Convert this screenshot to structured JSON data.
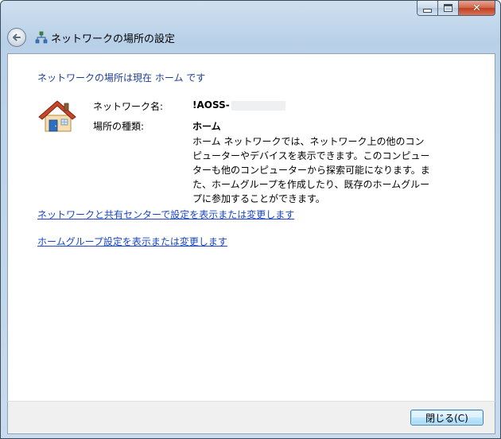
{
  "window": {
    "title": "ネットワークの場所の設定"
  },
  "caption": {
    "close_glyph": "✕"
  },
  "content": {
    "status_line": "ネットワークの場所は現在 ホーム です",
    "network_name_label": "ネットワーク名:",
    "network_name_value": "!AOSS-",
    "location_type_label": "場所の種類:",
    "location_type_value": "ホーム",
    "description": "ホーム ネットワークでは、ネットワーク上の他のコンピューターやデバイスを表示できます。このコンピューターも他のコンピューターから探索可能になります。また、ホームグループを作成したり、既存のホームグループに参加することができます。",
    "link_network_center": "ネットワークと共有センターで設定を表示または変更します",
    "link_homegroup": "ホームグループ設定を表示または変更します"
  },
  "footer": {
    "close_button_label": "閉じる(C)"
  },
  "icons": {
    "back": "back-arrow-icon",
    "network": "network-icon",
    "home": "house-icon"
  },
  "colors": {
    "link": "#1a46c7",
    "heading": "#1e3f91",
    "close_button": "#c0401f"
  }
}
